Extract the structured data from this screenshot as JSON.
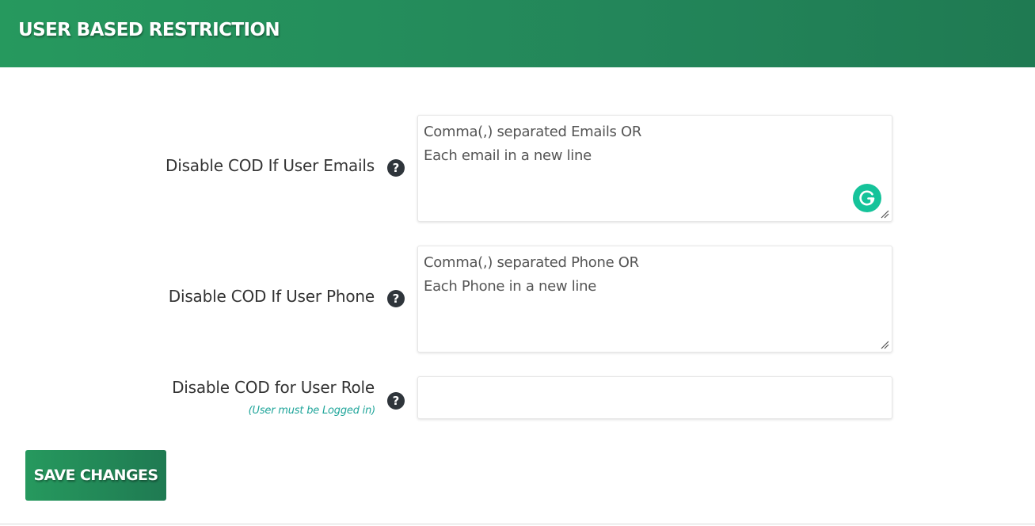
{
  "header": {
    "title": "USER BASED RESTRICTION"
  },
  "rows": [
    {
      "label": "Disable COD If User Emails",
      "placeholder": "Comma(,) separated Emails OR\nEach email in a new line",
      "help_icon": "question-circle-icon",
      "value": ""
    },
    {
      "label": "Disable COD If User Phone",
      "placeholder": "Comma(,) separated Phone OR\nEach Phone in a new line",
      "help_icon": "question-circle-icon",
      "value": ""
    },
    {
      "label": "Disable COD for User Role",
      "sublabel": "(User must be Logged in)",
      "help_icon": "question-circle-icon",
      "value": ""
    }
  ],
  "save_button": {
    "label": "SAVE CHANGES"
  },
  "colors": {
    "brand_green": "#23865a",
    "grammarly": "#15c39a",
    "sublabel": "#1fa59a"
  }
}
